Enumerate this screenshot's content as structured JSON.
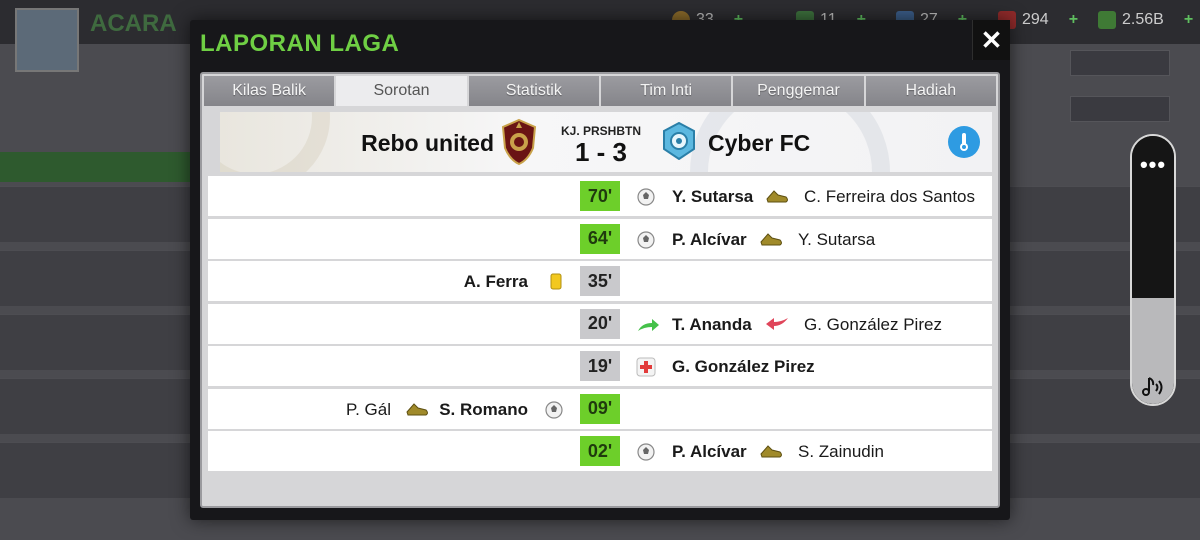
{
  "background": {
    "title": "ACARA",
    "resources": [
      {
        "name": "coins-icon",
        "value": "33",
        "color": "#c79a3a"
      },
      {
        "name": "tokens-icon",
        "value": "11",
        "color": "#4d9a4d"
      },
      {
        "name": "energy-icon",
        "value": "27",
        "color": "#4f7fbf"
      },
      {
        "name": "medkit-icon",
        "value": "294",
        "color": "#cc3a3a"
      },
      {
        "name": "cash-icon",
        "value": "2.56B",
        "color": "#5aa04a"
      }
    ]
  },
  "modal": {
    "title": "LAPORAN LAGA",
    "close_icon": "close-icon"
  },
  "tabs": [
    "Kilas Balik",
    "Sorotan",
    "Statistik",
    "Tim Inti",
    "Penggemar",
    "Hadiah"
  ],
  "active_tab": 1,
  "match": {
    "home_team": "Rebo united",
    "away_team": "Cyber FC",
    "score_label": "KJ. PRSHBTN",
    "score": "1 - 3"
  },
  "events": [
    {
      "minute": "70'",
      "type": "goal",
      "side": "away",
      "player": "Y. Sutarsa",
      "assist": "C. Ferreira dos Santos"
    },
    {
      "minute": "64'",
      "type": "goal",
      "side": "away",
      "player": "P. Alcívar",
      "assist": "Y. Sutarsa"
    },
    {
      "minute": "35'",
      "type": "yellow-card",
      "side": "home",
      "player": "A. Ferra"
    },
    {
      "minute": "20'",
      "type": "substitution",
      "side": "away",
      "player": "T. Ananda",
      "assist": "G. González Pirez"
    },
    {
      "minute": "19'",
      "type": "injury",
      "side": "away",
      "player": "G. González Pirez"
    },
    {
      "minute": "09'",
      "type": "goal",
      "side": "home",
      "player": "S. Romano",
      "assist": "P. Gál"
    },
    {
      "minute": "02'",
      "type": "goal",
      "side": "away",
      "player": "P. Alcívar",
      "assist": "S. Zainudin"
    }
  ],
  "colors": {
    "accent_green": "#6fcf44",
    "goal_minute": "#6dcf2a",
    "info_blue": "#2e9be2"
  }
}
